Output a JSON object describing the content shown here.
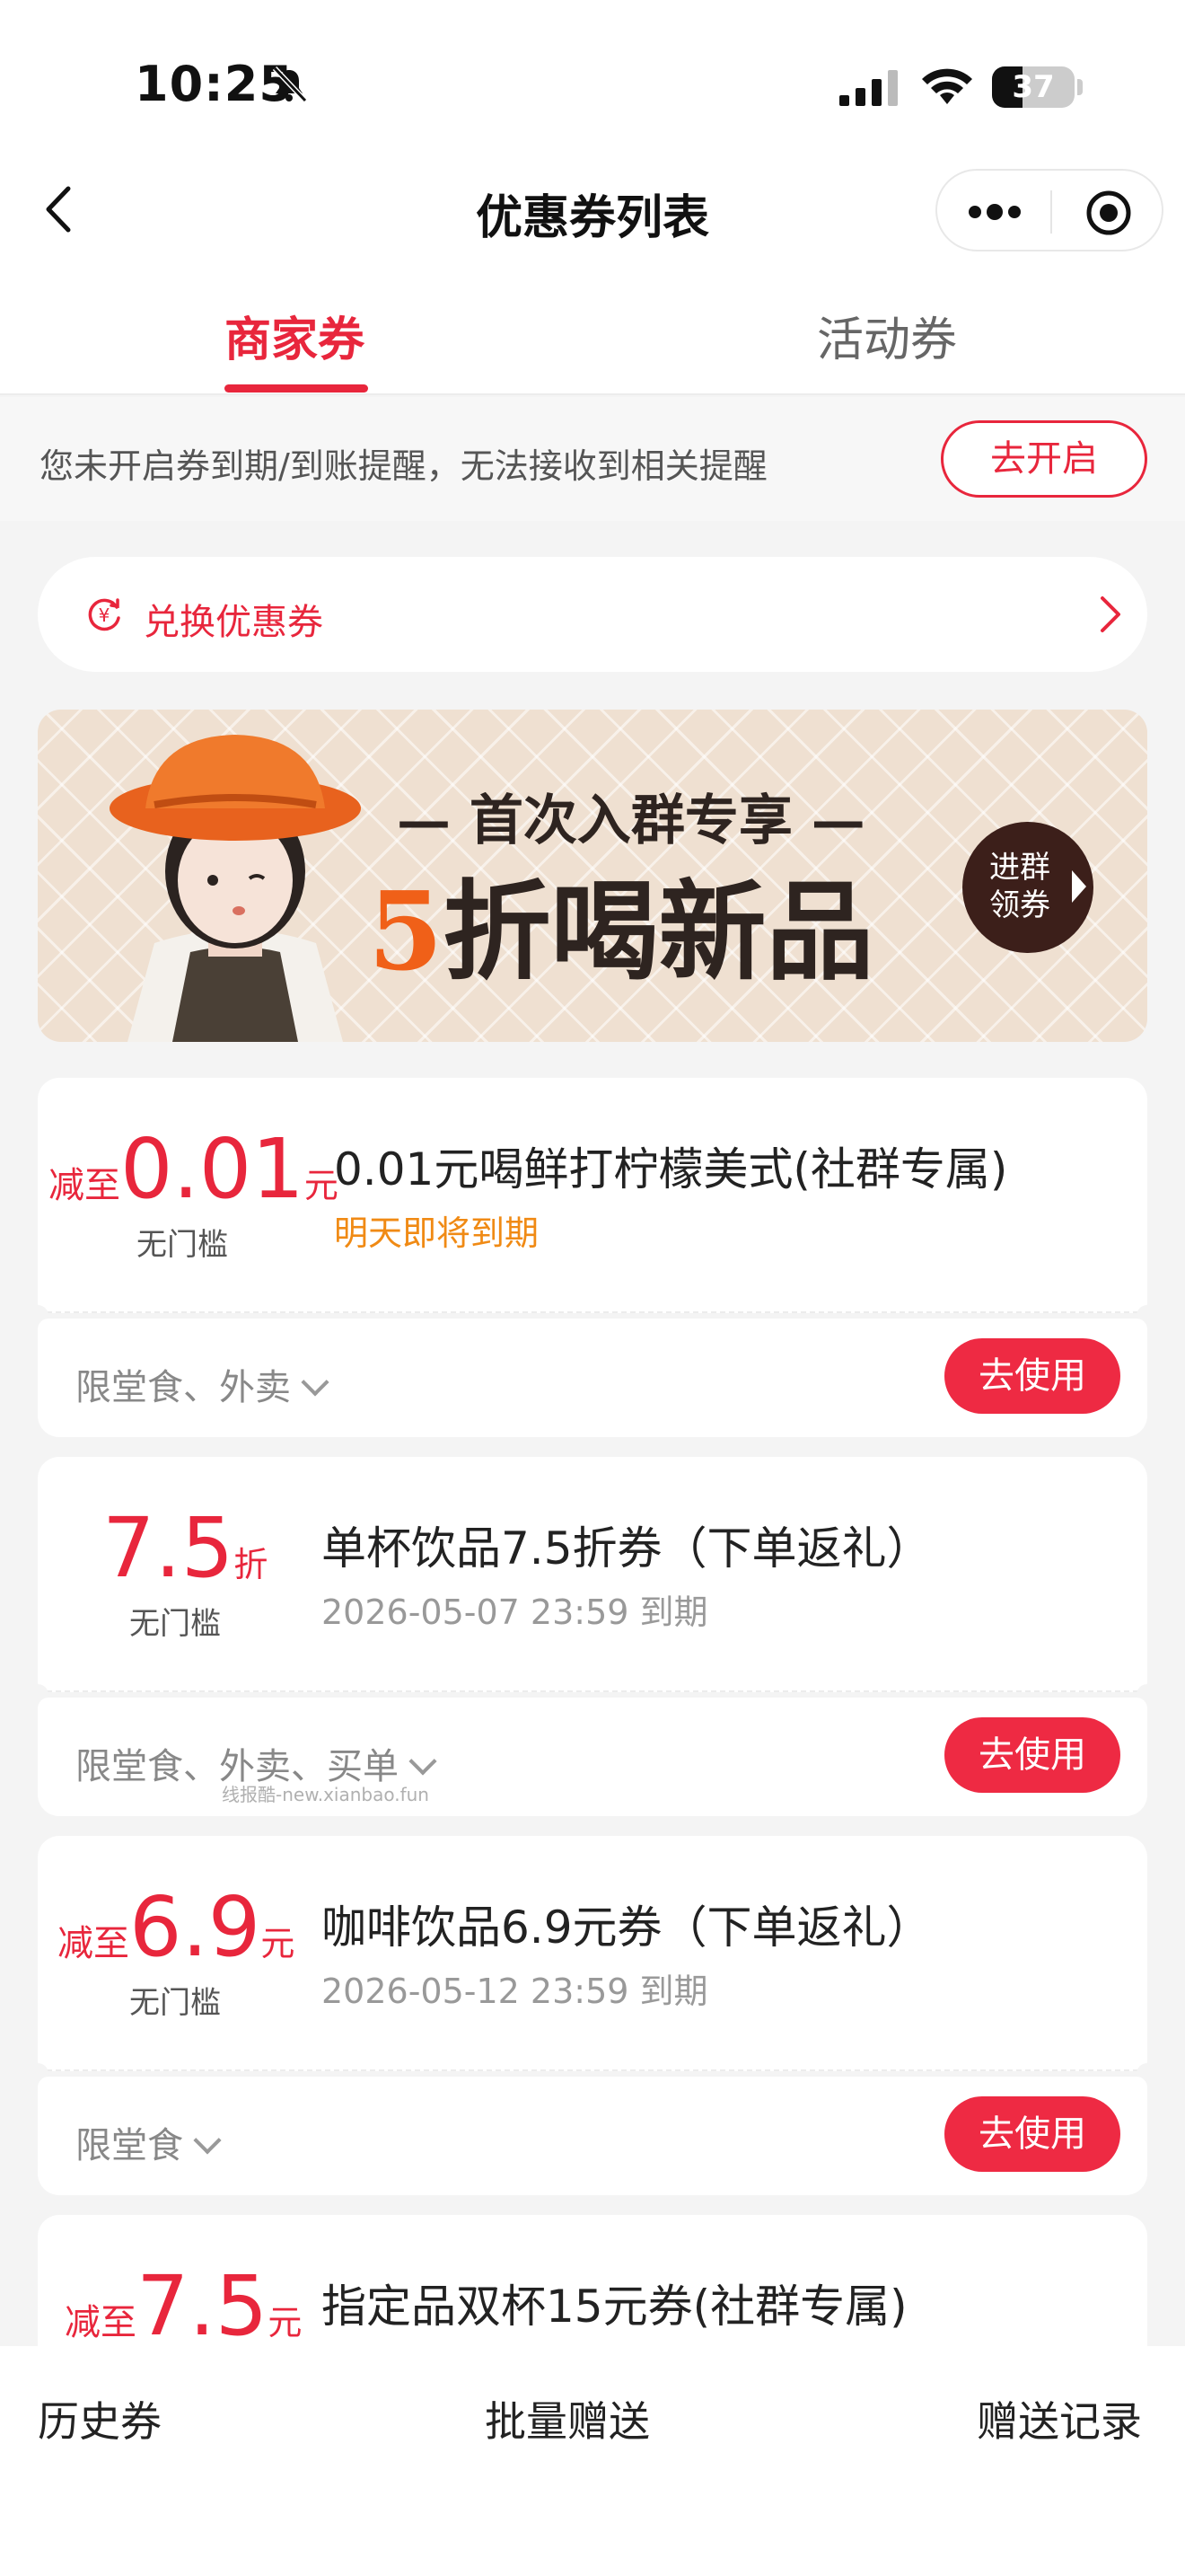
{
  "status_bar": {
    "time": "10:25",
    "battery": "37",
    "battery_level": 0.37
  },
  "nav": {
    "title": "优惠券列表",
    "back_icon": "chevron-left-icon",
    "more_icon": "more-dots-icon",
    "close_icon": "target-circle-icon"
  },
  "tabs": [
    {
      "label": "商家券",
      "active": true
    },
    {
      "label": "活动券",
      "active": false
    }
  ],
  "reminder": {
    "text": "您未开启券到期/到账提醒，无法接收到相关提醒",
    "button": "去开启"
  },
  "exchange": {
    "label": "兑换优惠券",
    "icon": "yuan-exchange-icon"
  },
  "banner": {
    "subtitle": "— 首次入群专享 —",
    "number": "5",
    "headline": "折喝新品",
    "button_line1": "进群",
    "button_line2": "领券"
  },
  "coupons": [
    {
      "prefix": "减至",
      "value": "0.01",
      "unit": "元",
      "threshold": "无门槛",
      "title": "0.01元喝鲜打柠檬美式(社群专属)",
      "expiry": "明天即将到期",
      "scope": "限堂食、外卖",
      "action": "去使用"
    },
    {
      "prefix": "",
      "value": "7.5",
      "unit": "折",
      "threshold": "无门槛",
      "title": "单杯饮品7.5折券（下单返礼）",
      "expiry": "2026-05-07 23:59 到期",
      "scope": "限堂食、外卖、买单",
      "action": "去使用"
    },
    {
      "prefix": "减至",
      "value": "6.9",
      "unit": "元",
      "threshold": "无门槛",
      "title": "咖啡饮品6.9元券（下单返礼）",
      "expiry": "2026-05-12 23:59 到期",
      "scope": "限堂食",
      "action": "去使用"
    },
    {
      "prefix": "减至",
      "value": "7.5",
      "unit": "元",
      "title": "指定品双杯15元券(社群专属)"
    }
  ],
  "watermark": "线报酷-new.xianbao.fun",
  "bottom_bar": {
    "history": "历史券",
    "batch_gift": "批量赠送",
    "gift_record": "赠送记录"
  },
  "colors": {
    "accent": "#e8263c",
    "warning": "#f08a14",
    "banner_number": "#f06018"
  }
}
